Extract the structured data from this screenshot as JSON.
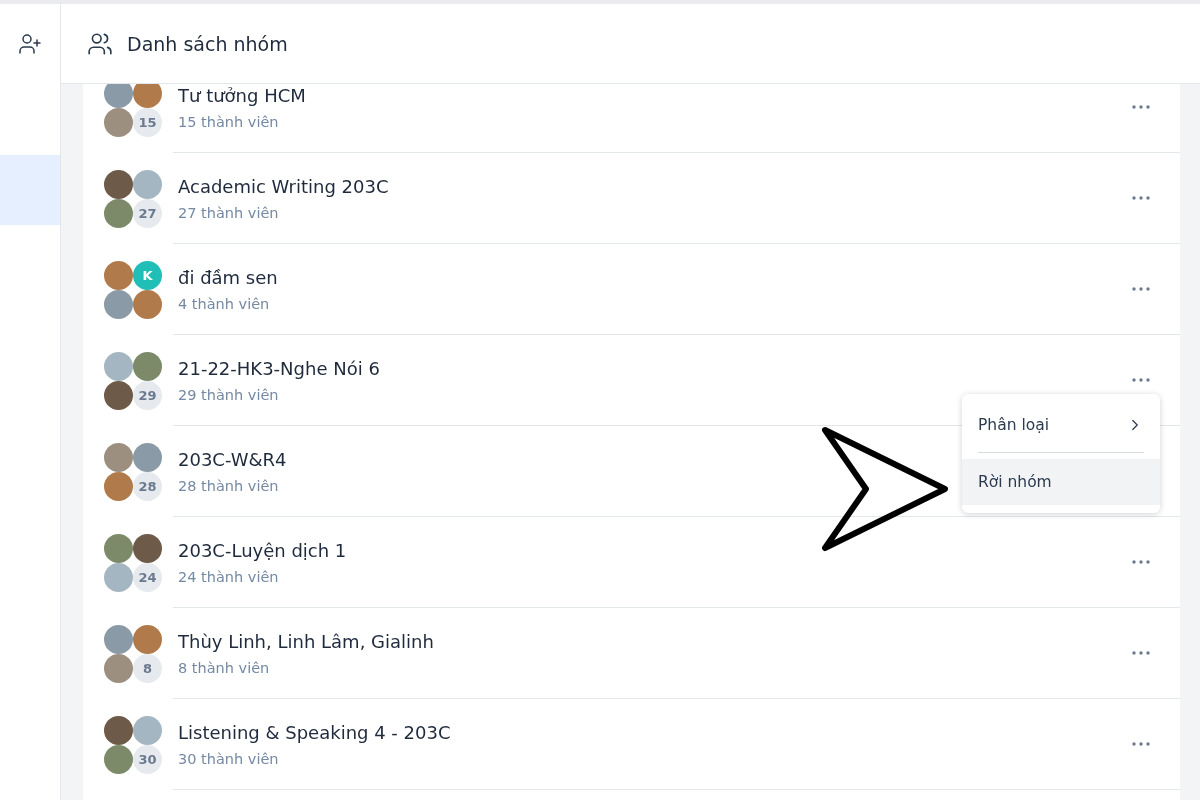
{
  "sidebar": {
    "items": [
      {
        "kind": "add-group",
        "selected": false
      },
      {
        "kind": "blank",
        "selected": true
      }
    ]
  },
  "header": {
    "title": "Danh sách nhóm"
  },
  "groups": [
    {
      "title": "Tư tưởng HCM",
      "members": "15 thành viên",
      "avatars": [
        {
          "kind": "photo"
        },
        {
          "kind": "photo"
        },
        {
          "kind": "photo"
        },
        {
          "kind": "count",
          "text": "15"
        }
      ]
    },
    {
      "title": "Academic Writing 203C",
      "members": "27 thành viên",
      "avatars": [
        {
          "kind": "photo"
        },
        {
          "kind": "photo"
        },
        {
          "kind": "photo"
        },
        {
          "kind": "count",
          "text": "27"
        }
      ]
    },
    {
      "title": "đi đầm sen",
      "members": "4 thành viên",
      "avatars": [
        {
          "kind": "photo"
        },
        {
          "kind": "letter",
          "text": "K",
          "color": "#1fbfb8"
        },
        {
          "kind": "photo"
        },
        {
          "kind": "photo"
        }
      ]
    },
    {
      "title": "21-22-HK3-Nghe Nói 6",
      "members": "29 thành viên",
      "avatars": [
        {
          "kind": "photo"
        },
        {
          "kind": "photo"
        },
        {
          "kind": "photo"
        },
        {
          "kind": "count",
          "text": "29"
        }
      ]
    },
    {
      "title": "203C-W&R4",
      "members": "28 thành viên",
      "avatars": [
        {
          "kind": "photo"
        },
        {
          "kind": "photo"
        },
        {
          "kind": "photo"
        },
        {
          "kind": "count",
          "text": "28"
        }
      ]
    },
    {
      "title": "203C-Luyện dịch 1",
      "members": "24 thành viên",
      "avatars": [
        {
          "kind": "photo"
        },
        {
          "kind": "photo"
        },
        {
          "kind": "photo"
        },
        {
          "kind": "count",
          "text": "24"
        }
      ]
    },
    {
      "title": "Thùy Linh, Linh Lâm, Gialinh",
      "members": "8 thành viên",
      "avatars": [
        {
          "kind": "photo"
        },
        {
          "kind": "photo"
        },
        {
          "kind": "photo"
        },
        {
          "kind": "count",
          "text": "8"
        }
      ]
    },
    {
      "title": "Listening & Speaking 4 - 203C",
      "members": "30 thành viên",
      "avatars": [
        {
          "kind": "photo"
        },
        {
          "kind": "photo"
        },
        {
          "kind": "photo"
        },
        {
          "kind": "count",
          "text": "30"
        }
      ]
    }
  ],
  "context_menu": {
    "items": [
      {
        "label": "Phân loại",
        "submenu": true,
        "highlighted": false
      },
      {
        "label": "Rời nhóm",
        "submenu": false,
        "highlighted": true
      }
    ]
  }
}
